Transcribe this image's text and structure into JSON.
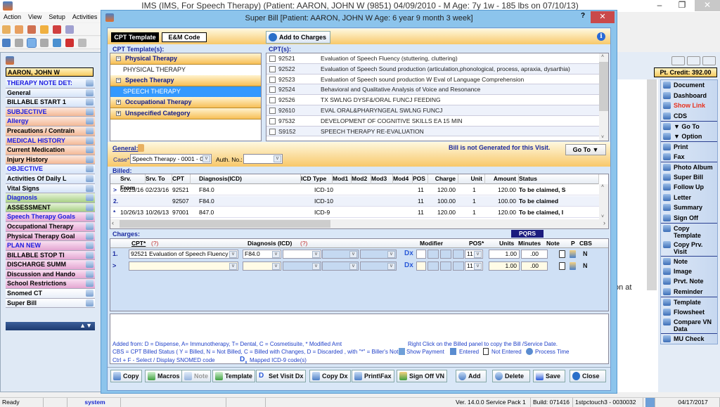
{
  "app": {
    "title": "IMS (IMS, For Speech Therapy)    (Patient: AARON, JOHN W (9851) 04/09/2010 - M Age: 7y 1w - 185 lbs on 07/10/13)",
    "window_controls": {
      "minimize": "–",
      "restore": "❐",
      "close": "✕"
    },
    "menu": [
      "Action",
      "View",
      "Setup",
      "Activities"
    ]
  },
  "left_panel": {
    "patient_name": "AARON, JOHN W",
    "items": [
      {
        "label": "THERAPY NOTE DET:",
        "color": "blue",
        "text": "blue"
      },
      {
        "label": "General",
        "color": "blue",
        "text": "black"
      },
      {
        "label": "BILLABLE START 1",
        "color": "blue",
        "text": "black"
      },
      {
        "label": "SUBJECTIVE",
        "color": "orange",
        "text": "blue"
      },
      {
        "label": "Allergy",
        "color": "orange",
        "text": "blue"
      },
      {
        "label": "Precautions / Contrain",
        "color": "orange",
        "text": "black"
      },
      {
        "label": "MEDICAL HISTORY",
        "color": "orange",
        "text": "blue"
      },
      {
        "label": "Current Medication",
        "color": "orange",
        "text": "black"
      },
      {
        "label": "Injury History",
        "color": "orange",
        "text": "black"
      },
      {
        "label": "OBJECTIVE",
        "color": "blue",
        "text": "blue"
      },
      {
        "label": "Activities Of Daily L",
        "color": "blue",
        "text": "black"
      },
      {
        "label": "Vital Signs",
        "color": "blue",
        "text": "black"
      },
      {
        "label": "Diagnosis",
        "color": "green",
        "text": "blue"
      },
      {
        "label": "ASSESSMENT",
        "color": "green",
        "text": "black"
      },
      {
        "label": "Speech Therapy Goals",
        "color": "pink",
        "text": "blue"
      },
      {
        "label": "Occupational Therapy",
        "color": "pink",
        "text": "black"
      },
      {
        "label": "Physical Therapy Goal",
        "color": "pink",
        "text": "black"
      },
      {
        "label": "PLAN NEW",
        "color": "pink",
        "text": "blue"
      },
      {
        "label": "BILLABLE STOP TI",
        "color": "pink",
        "text": "black"
      },
      {
        "label": "DISCHARGE SUMM",
        "color": "pink",
        "text": "black"
      },
      {
        "label": "Discussion and Hando",
        "color": "pink",
        "text": "black"
      },
      {
        "label": "School Restrictions",
        "color": "pink",
        "text": "black"
      },
      {
        "label": "Snomed CT",
        "color": "white",
        "text": "black"
      },
      {
        "label": "Super Bill",
        "color": "white",
        "text": "black"
      }
    ]
  },
  "right_panel": {
    "pt_credit": "Pt. Credit: 392.00",
    "background_text": "on at",
    "menu": [
      {
        "label": "Document",
        "color": "#000000",
        "sep": false
      },
      {
        "label": "Dashboard",
        "color": "#000000",
        "sep": false
      },
      {
        "label": "Show Link",
        "color": "#e8301c",
        "sep": false
      },
      {
        "label": "CDS",
        "color": "#000000",
        "sep": false
      },
      {
        "label": "▼ Go To",
        "color": "#000000",
        "sep": true
      },
      {
        "label": "▼ Option",
        "color": "#000000",
        "sep": false
      },
      {
        "label": "Print",
        "color": "#000000",
        "sep": true
      },
      {
        "label": "Fax",
        "color": "#000000",
        "sep": false
      },
      {
        "label": "Photo Album",
        "color": "#000000",
        "sep": true
      },
      {
        "label": "Super Bill",
        "color": "#000000",
        "sep": false
      },
      {
        "label": "Follow Up",
        "color": "#000000",
        "sep": false
      },
      {
        "label": "Letter",
        "color": "#000000",
        "sep": false
      },
      {
        "label": "Summary",
        "color": "#000000",
        "sep": false
      },
      {
        "label": "Sign Off",
        "color": "#000000",
        "sep": false
      },
      {
        "label": "Copy Template",
        "color": "#000000",
        "sep": true
      },
      {
        "label": "Copy Prv. Visit",
        "color": "#000000",
        "sep": false
      },
      {
        "label": "Note",
        "color": "#000000",
        "sep": true
      },
      {
        "label": "Image",
        "color": "#000000",
        "sep": false
      },
      {
        "label": "Prvt. Note",
        "color": "#000000",
        "sep": false
      },
      {
        "label": "Reminder",
        "color": "#000000",
        "sep": false
      },
      {
        "label": "Template",
        "color": "#000000",
        "sep": true
      },
      {
        "label": "Flowsheet",
        "color": "#000000",
        "sep": false
      },
      {
        "label": "Compare VN Data",
        "color": "#000000",
        "sep": false
      },
      {
        "label": "MU Check",
        "color": "#000000",
        "sep": true
      }
    ]
  },
  "dialog": {
    "title": "Super Bill  [Patient: AARON, JOHN W  Age: 6 year 9 month 3 week]",
    "help": "?",
    "close": "✕",
    "tabs": {
      "cpt_template": "CPT Template",
      "em_code": "E&M Code"
    },
    "add_to_charges": "Add to Charges",
    "info": "i",
    "templates_label": "CPT Template(s):",
    "templates": [
      {
        "category": "Physical Therapy",
        "expanded": true,
        "items": [
          "PHYSICAL THERAPY"
        ]
      },
      {
        "category": "Speech Therapy",
        "expanded": true,
        "items": [
          "SPEECH THERAPY"
        ],
        "selected": "SPEECH THERAPY"
      },
      {
        "category": "Occupational Therapy",
        "expanded": false,
        "items": []
      },
      {
        "category": "Unspecified Category",
        "expanded": false,
        "items": []
      }
    ],
    "cpts_label": "CPT(s):",
    "cpts": [
      {
        "code": "92521",
        "desc": "Evaluation of Speech Fluency (stuttering, cluttering)"
      },
      {
        "code": "92522",
        "desc": "Evaluation of Speech Sound production (articulation,phonological, process, apraxia, dysarthia)"
      },
      {
        "code": "92523",
        "desc": "Evaluation of Speech sound production W Eval of Language Comprehension"
      },
      {
        "code": "92524",
        "desc": "Behavioral and Qualitative Analysis of Voice and Resonance"
      },
      {
        "code": "92526",
        "desc": "TX SWLNG DYSF&/ORAL FUNCJ FEEDING"
      },
      {
        "code": "92610",
        "desc": "EVAL ORAL&PHARYNGEAL SWLNG FUNCJ"
      },
      {
        "code": "97532",
        "desc": "DEVELOPMENT OF COGNITIVE SKILLS EA 15 MIN"
      },
      {
        "code": "S9152",
        "desc": "SPEECH THERAPY RE-EVALUATION"
      }
    ],
    "general": {
      "label": "General:",
      "bill_status": "Bill is not Generated for this Visit.",
      "goto": "Go To  ▼",
      "case_label": "Case*",
      "case_value": "Speech Therapy  -  0001 - 0",
      "auth_label": "Auth. No.:",
      "auth_value": ""
    },
    "billed": {
      "label": "Billed:",
      "columns": [
        "Srv. From",
        "Srv. To",
        "CPT",
        "Diagnosis(ICD)",
        "ICD Type",
        "Mod1",
        "Mod2",
        "Mod3",
        "Mod4",
        "POS",
        "Charge",
        "Unit",
        "Amount",
        "Status"
      ],
      "rows": [
        {
          "marker": ">",
          "from": "02/23/16",
          "to": "02/23/16",
          "cpt": "92521",
          "dx": "F84.0",
          "icd": "ICD-10",
          "pos": "11",
          "charge": "120.00",
          "unit": "1",
          "amount": "120.00",
          "status": "To be claimed, S"
        },
        {
          "marker": "2.",
          "from": "",
          "to": "",
          "cpt": "92507",
          "dx": "F84.0",
          "icd": "ICD-10",
          "pos": "11",
          "charge": "100.00",
          "unit": "1",
          "amount": "100.00",
          "status": "To be claimed"
        },
        {
          "marker": "*",
          "from": "10/26/13",
          "to": "10/26/13",
          "cpt": "97001",
          "dx": "847.0",
          "icd": "ICD-9",
          "pos": "11",
          "charge": "120.00",
          "unit": "1",
          "amount": "120.00",
          "status": "To be claimed, I"
        }
      ]
    },
    "charges": {
      "label": "Charges:",
      "pqrs": "PQRS",
      "columns": {
        "cpt": "CPT*",
        "cpt_help": "(?)",
        "dx": "Diagnosis (ICD)",
        "dx_help": "(?)",
        "modifier": "Modifier",
        "pos": "POS*",
        "units": "Units",
        "minutes": "Minutes",
        "note": "Note",
        "p": "P",
        "cbs": "CBS"
      },
      "rows": [
        {
          "marker": "1.",
          "cpt": "92521    Evaluation of Speech Fluency",
          "dx1": "F84.0",
          "pos": "11",
          "units": "1.00",
          "minutes": ".00",
          "cbs": "N"
        },
        {
          "marker": ">",
          "cpt": "",
          "dx1": "",
          "pos": "11",
          "units": "1.00",
          "minutes": ".00",
          "cbs": "N"
        }
      ],
      "dx_button": "Dx"
    },
    "legend": {
      "line1a": "Added from: D = Dispense, A= Immunotherapy, T= Dental,  C = Cosmetisuite,   * Modified Amt",
      "line1b": "Right Click on the Billed panel to copy the Bill /Service Date.",
      "line2": "CBS = CPT Billed Status ( Y = Billed, N = Not Billed, C = Billed with Changes, D = Discarded , with \"*\" = Biller's Note )",
      "show_payment": "Show Payment",
      "entered": "Entered",
      "not_entered": "Not Entered",
      "process_time": "Process Time",
      "line3": "Ctrl + F - Select / Display SNOMED code",
      "mapped": "Mapped ICD-9 code(s)"
    },
    "buttons": {
      "copy": "Copy",
      "macros": "Macros",
      "note": "Note",
      "template": "Template",
      "set_visit_dx": "Set Visit Dx",
      "copy_dx": "Copy Dx",
      "print_fax": "Print\\Fax",
      "sign_off_vn": "Sign Off VN",
      "add": "Add",
      "delete": "Delete",
      "save": "Save",
      "close": "Close"
    }
  },
  "statusbar": {
    "status": "Ready",
    "user": "system",
    "version": "Ver. 14.0.0 Service Pack 1",
    "build": "Build: 071416",
    "server": "1stpctouch3 - 0030032",
    "date": "04/17/2017"
  }
}
